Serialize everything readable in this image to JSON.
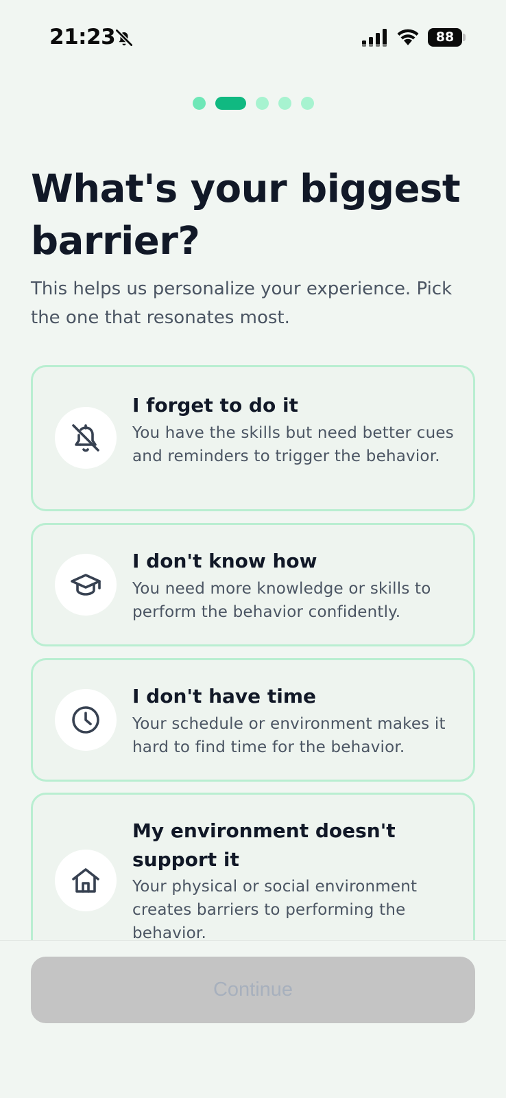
{
  "status_bar": {
    "time": "21:23",
    "battery": "88",
    "icons": [
      "bell-off-icon",
      "signal-icon",
      "wifi-icon",
      "battery-icon"
    ]
  },
  "progress": {
    "total_steps": 5,
    "current_step": 2,
    "active_color": "#10b981",
    "inactive_color": "#a7f3d0"
  },
  "header": {
    "title": "What's your biggest barrier?",
    "subtitle": "This helps us personalize your experience. Pick the one that resonates most."
  },
  "options": [
    {
      "icon": "bell-off-icon",
      "title": "I forget to do it",
      "description": "You have the skills but need better cues and reminders to trigger the behavior."
    },
    {
      "icon": "graduation-cap-icon",
      "title": "I don't know how",
      "description": "You need more knowledge or skills to perform the behavior confidently."
    },
    {
      "icon": "clock-icon",
      "title": "I don't have time",
      "description": "Your schedule or environment makes it hard to find time for the behavior."
    },
    {
      "icon": "home-icon",
      "title": "My environment doesn't support it",
      "description": "Your physical or social environment creates barriers to performing the behavior."
    }
  ],
  "footer": {
    "continue_label": "Continue",
    "continue_enabled": false
  },
  "colors": {
    "background": "#f1f6f2",
    "card_border": "#b9eed1",
    "accent": "#10b981",
    "disabled_button": "#c4c4c4"
  }
}
